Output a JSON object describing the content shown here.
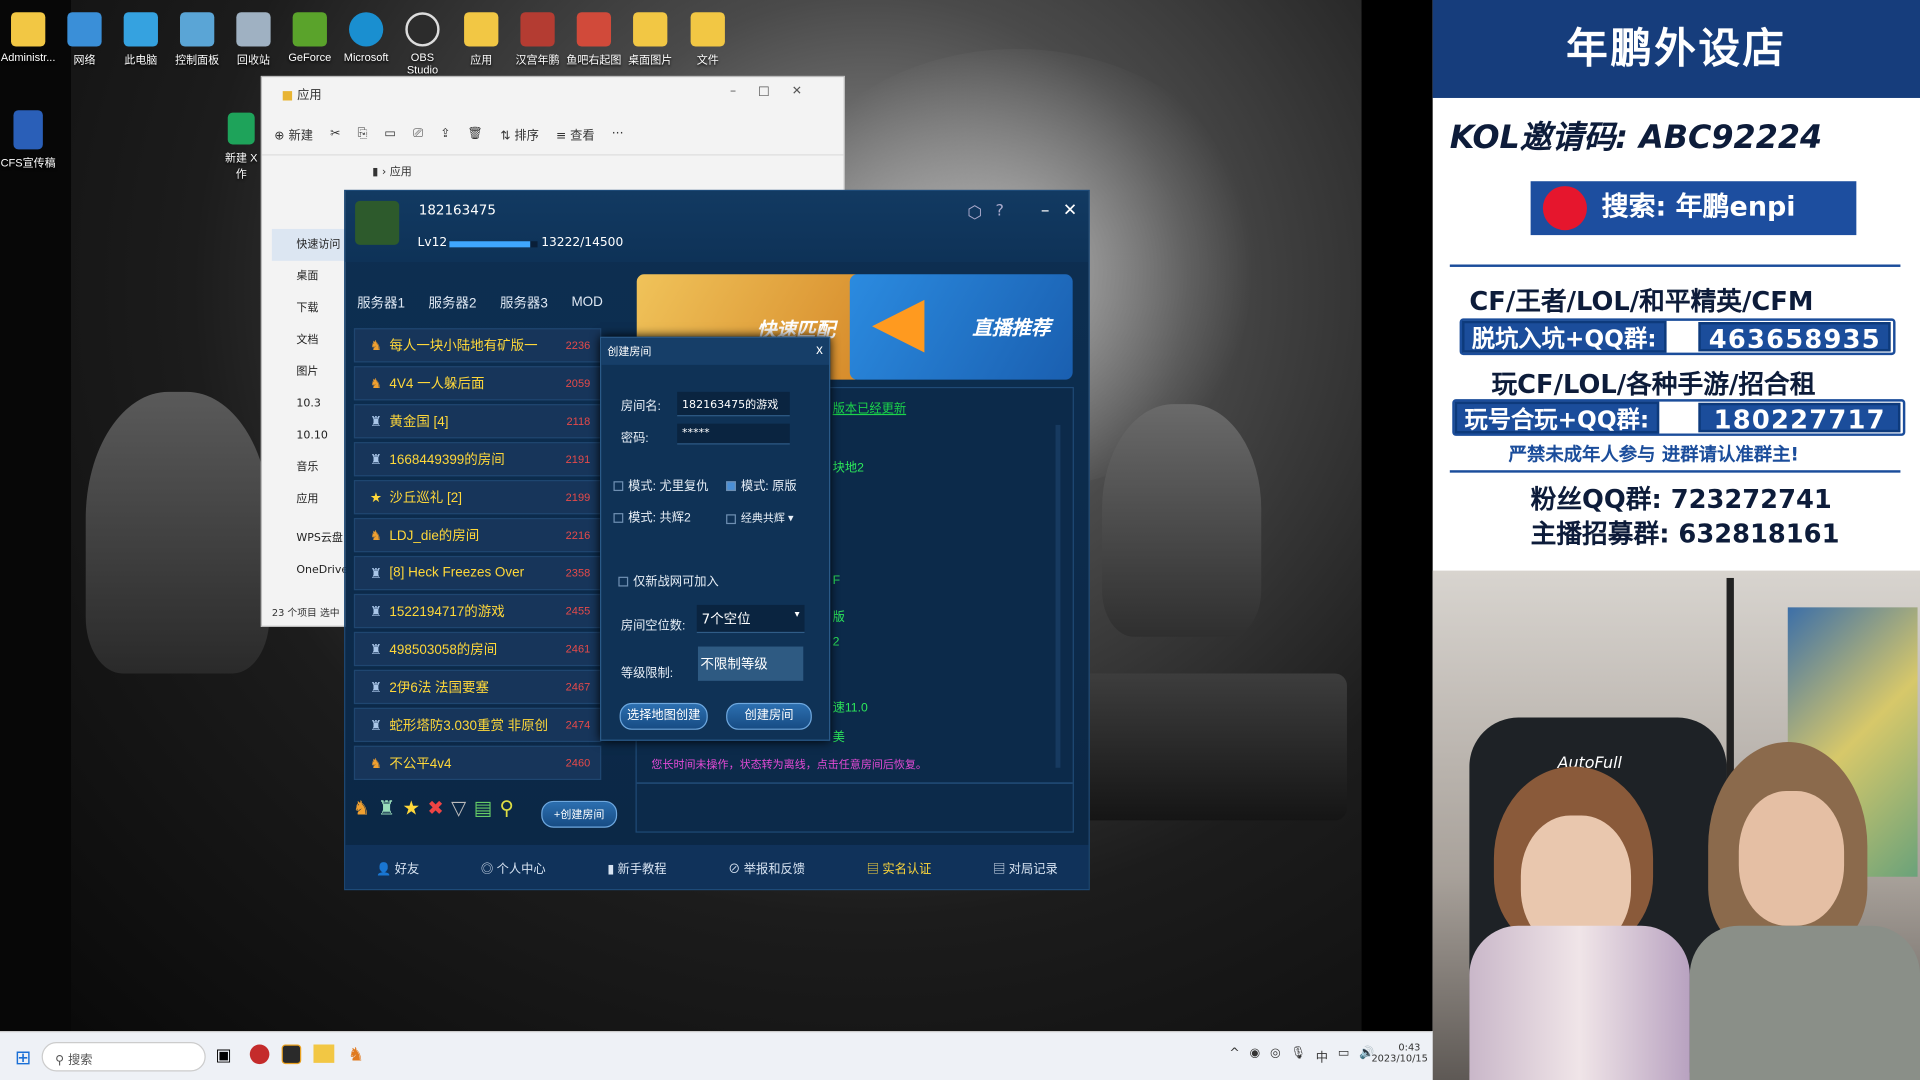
{
  "desktop": {
    "icons": [
      "Administr...",
      "网络",
      "此电脑",
      "控制面板",
      "回收站",
      "GeForce",
      "Microsoft",
      "OBS Studio",
      "应用",
      "汉宫年鹏",
      "鱼吧右起图",
      "桌面图片",
      "文件"
    ],
    "left_icon": "CFS宣传稿",
    "partial_icon": "新建 X 作"
  },
  "explorer": {
    "title": "应用",
    "toolbar": [
      "新建",
      "排序",
      "查看",
      "···"
    ],
    "path": "应用",
    "nav": [
      "快速访问",
      "桌面",
      "下载",
      "文档",
      "图片",
      "10.3",
      "10.10",
      "音乐",
      "应用",
      "WPS云盘",
      "OneDrive"
    ],
    "status": "23 个项目",
    "status2": "选中"
  },
  "game": {
    "user_id": "182163475",
    "level": "Lv12",
    "exp": "13222/14500",
    "exp_fraction": 0.912,
    "tabs": [
      "服务器1",
      "服务器2",
      "服务器3",
      "MOD"
    ],
    "rooms": [
      {
        "name": "每人一块小陆地有矿版一",
        "count": "2236",
        "icon": "soldier"
      },
      {
        "name": "4V4 一人躲后面",
        "count": "2059",
        "icon": "soldier"
      },
      {
        "name": "黄金国 [4]",
        "count": "2118",
        "icon": "tower"
      },
      {
        "name": "1668449399的房间",
        "count": "2191",
        "icon": "tower"
      },
      {
        "name": "沙丘巡礼 [2]",
        "count": "2199",
        "icon": "star"
      },
      {
        "name": "LDJ_die的房间",
        "count": "2216",
        "icon": "soldier"
      },
      {
        "name": "[8] Heck Freezes Over",
        "count": "2358",
        "icon": "tower"
      },
      {
        "name": "1522194717的游戏",
        "count": "2455",
        "icon": "tower"
      },
      {
        "name": "498503058的房间",
        "count": "2461",
        "icon": "tower"
      },
      {
        "name": "2伊6法 法国要塞",
        "count": "2467",
        "icon": "tower"
      },
      {
        "name": "蛇形塔防3.030重赏 非原创",
        "count": "2474",
        "icon": "tower"
      },
      {
        "name": "不公平4v4",
        "count": "2460",
        "icon": "soldier"
      }
    ],
    "create_room_btn": "+创建房间",
    "banner1": "快速匹配",
    "banner2": "直播推荐",
    "update_text": "版本已经更新",
    "green_lines": [
      "块地2",
      "F",
      "版",
      "2",
      "速11.0",
      "美"
    ],
    "idle_msg": "您长时间未操作，状态转为离线，点击任意房间后恢复。",
    "bottom": [
      "好友",
      "个人中心",
      "新手教程",
      "举报和反馈",
      "实名认证",
      "对局记录"
    ]
  },
  "dialog": {
    "title": "创建房间",
    "close": "x",
    "room_name_label": "房间名:",
    "room_name": "182163475的游戏",
    "password_label": "密码:",
    "password": "*****",
    "mode1": "模式: 尤里复仇",
    "mode2": "模式: 原版",
    "mode3": "模式: 共辉2",
    "mode4": "经典共辉",
    "newnet_only": "仅新战网可加入",
    "slots_label": "房间空位数:",
    "slots": "7个空位",
    "level_label": "等级限制:",
    "level": "不限制等级",
    "btn_map": "选择地图创建",
    "btn_create": "创建房间"
  },
  "right": {
    "title": "年鹏外设店",
    "kol": "KOL邀请码: ABC92224",
    "search": "搜索: 年鹏enpi",
    "line1": "CF/王者/LOL/和平精英/CFM",
    "qq1_label": "脱坑入坑+QQ群:",
    "qq1": "463658935",
    "line2": "玩CF/LOL/各种手游/招合租",
    "qq2_label": "玩号合玩+QQ群:",
    "qq2": "180227717",
    "warn": "严禁未成年人参与  进群请认准群主!",
    "fans": "粉丝QQ群: 723272741",
    "anchor": "主播招募群: 632818161",
    "chair": "AutoFull"
  },
  "taskbar": {
    "search": "搜索",
    "time": "0:43",
    "date": "2023/10/15",
    "ime": "中"
  }
}
